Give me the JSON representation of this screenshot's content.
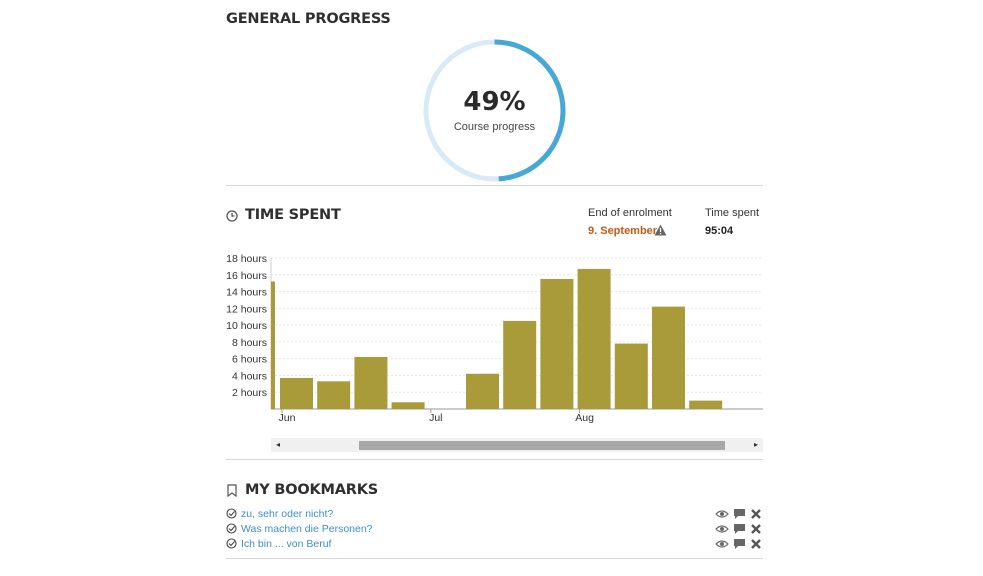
{
  "general_progress": {
    "title": "GENERAL PROGRESS",
    "percent": 49,
    "percent_label": "49%",
    "caption": "Course progress",
    "ring_color": "#45a8d6",
    "ring_track_color": "#d7eaf6"
  },
  "time_spent": {
    "title": "TIME SPENT",
    "icon": "clock-icon",
    "end_of_enrolment_label": "End of enrolment",
    "end_of_enrolment_value": "9. September",
    "end_of_enrolment_color": "#c55a11",
    "warning_icon": "warning-icon",
    "time_spent_label": "Time spent",
    "time_spent_value": "95:04",
    "scroll_left_glyph": "◂",
    "scroll_right_glyph": "▸"
  },
  "chart_data": {
    "type": "bar",
    "bar_color": "#a99b39",
    "y_ticks": [
      2,
      4,
      6,
      8,
      10,
      12,
      14,
      16,
      18
    ],
    "y_tick_labels": [
      "2 hours",
      "4 hours",
      "6 hours",
      "8 hours",
      "10 hours",
      "12 hours",
      "14 hours",
      "16 hours",
      "18 hours"
    ],
    "ylim": [
      0,
      18
    ],
    "x_tick_labels": [
      {
        "label": "Jun",
        "at_bar": 0.5
      },
      {
        "label": "Jul",
        "at_bar": 4.5
      },
      {
        "label": "Aug",
        "at_bar": 8.5
      }
    ],
    "values": [
      15.2,
      3.7,
      3.3,
      6.2,
      0.8,
      0,
      4.2,
      10.5,
      15.5,
      16.7,
      7.8,
      12.2,
      1.0
    ],
    "grid": true
  },
  "bookmarks": {
    "title": "MY BOOKMARKS",
    "icon": "bookmark-icon",
    "items": [
      {
        "label": "zu, sehr oder nicht?"
      },
      {
        "label": "Was machen die Personen?"
      },
      {
        "label": "Ich bin ... von Beruf"
      }
    ],
    "action_icons": [
      "eye-icon",
      "comment-icon",
      "close-icon"
    ]
  }
}
